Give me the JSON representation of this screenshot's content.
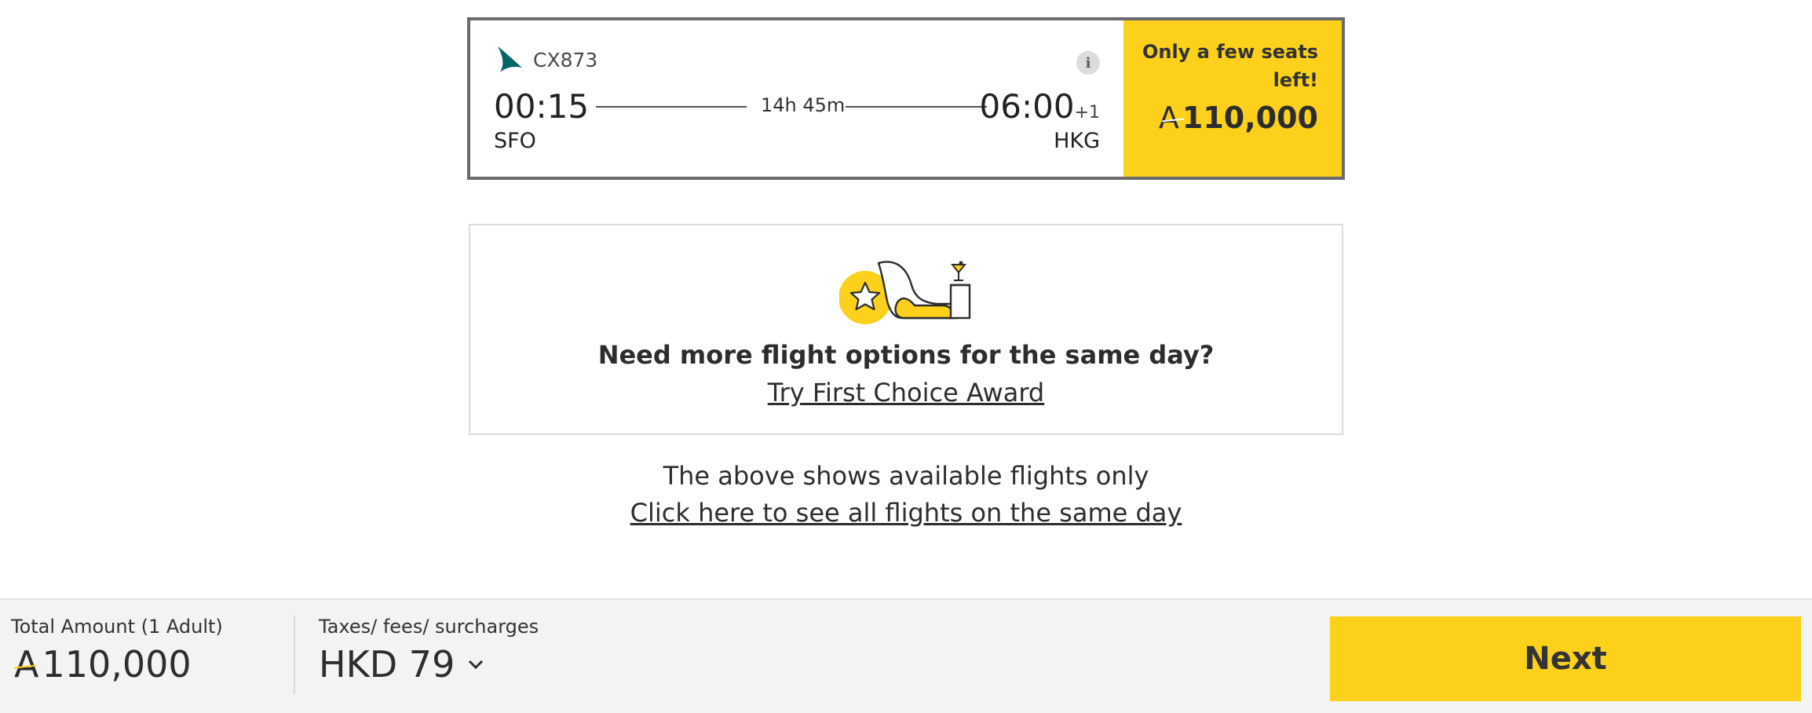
{
  "flight": {
    "airline_icon": "cathay-pacific-logo",
    "flight_number": "CX873",
    "info_icon": "i",
    "departure_time": "00:15",
    "departure_code": "SFO",
    "duration": "14h 45m",
    "arrival_time": "06:00",
    "arrival_day_offset": "+1",
    "arrival_code": "HKG",
    "availability_note": "Only a few seats left!",
    "price_symbol": "A",
    "price": "110,000"
  },
  "first_choice": {
    "illustration": "seat-star-illustration",
    "title": "Need more flight options for the same day?",
    "link_label": "Try First Choice Award"
  },
  "availability": {
    "note": "The above shows available flights only",
    "link_label": "Click here to see all flights on the same day"
  },
  "footer": {
    "total_label": "Total Amount (1 Adult)",
    "total_symbol": "A",
    "total_amount": "110,000",
    "tax_label": "Taxes/ fees/ surcharges",
    "tax_amount": "HKD 79",
    "next_label": "Next"
  },
  "colors": {
    "accent_yellow": "#fcd01b",
    "brand_teal": "#006564",
    "text_dark": "#2d2d2d"
  }
}
